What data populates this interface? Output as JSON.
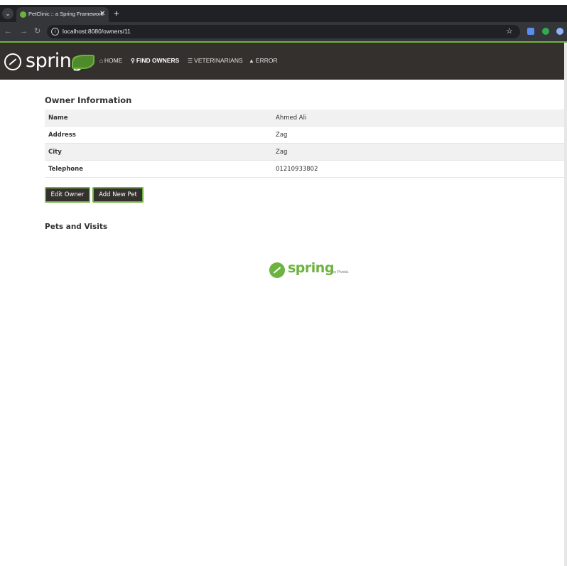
{
  "browser": {
    "tab_title": "PetClinic :: a Spring Framework",
    "tab_close": "✕",
    "new_tab": "+",
    "url": "localhost:8080/owners/11"
  },
  "brand": {
    "logo_text": "spring",
    "accent_color": "#6db33f",
    "navbar_color": "#34302d"
  },
  "nav": {
    "items": [
      {
        "label": "HOME",
        "icon": "home-icon"
      },
      {
        "label": "FIND OWNERS",
        "icon": "search-icon"
      },
      {
        "label": "VETERINARIANS",
        "icon": "list-icon"
      },
      {
        "label": "ERROR",
        "icon": "warning-icon"
      }
    ],
    "active": "FIND OWNERS"
  },
  "owner": {
    "heading": "Owner Information",
    "rows": [
      {
        "label": "Name",
        "value": "Ahmed Ali"
      },
      {
        "label": "Address",
        "value": "Zag"
      },
      {
        "label": "City",
        "value": "Zag"
      },
      {
        "label": "Telephone",
        "value": "01210933802"
      }
    ]
  },
  "actions": {
    "edit_owner": "Edit Owner",
    "add_pet": "Add New Pet"
  },
  "pets": {
    "heading": "Pets and Visits"
  },
  "footer": {
    "logo_text": "spring",
    "by_text": "by Pivotal."
  }
}
